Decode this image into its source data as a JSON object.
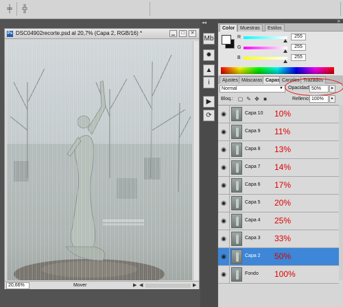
{
  "options_bar": {
    "tool_icons": [
      "align-center-icon",
      "distribute-icon"
    ]
  },
  "document": {
    "title": "DSC04902recorte.psd al 20,7% (Capa 2, RGB/16) *",
    "zoom": "20,66%",
    "status": "Mover"
  },
  "side_icons": [
    "mini-bridge-icon",
    "navigator-icon",
    "histogram-icon",
    "info-icon",
    "actions-icon",
    "history-icon"
  ],
  "color_panel": {
    "tabs": [
      "Color",
      "Muestras",
      "Estilos"
    ],
    "channels": [
      {
        "label": "R",
        "value": "255",
        "color": "#ff2020"
      },
      {
        "label": "G",
        "value": "255",
        "color": "#e020e0"
      },
      {
        "label": "B",
        "value": "255",
        "color": "#e0e020"
      }
    ]
  },
  "layers_panel": {
    "tabs": [
      "Ajustes",
      "Máscaras",
      "Capas",
      "Canales",
      "Trazados"
    ],
    "blend_mode": "Normal",
    "opacity_label": "Opacidad:",
    "opacity_value": "50%",
    "lock_label": "Bloq.:",
    "fill_label": "Relleno:",
    "fill_value": "100%",
    "layers": [
      {
        "name": "Capa 10",
        "note": "10%",
        "selected": false
      },
      {
        "name": "Capa 9",
        "note": "11%",
        "selected": false
      },
      {
        "name": "Capa 8",
        "note": "13%",
        "selected": false
      },
      {
        "name": "Capa 7",
        "note": "14%",
        "selected": false
      },
      {
        "name": "Capa 6",
        "note": "17%",
        "selected": false
      },
      {
        "name": "Capa 5",
        "note": "20%",
        "selected": false
      },
      {
        "name": "Capa 4",
        "note": "25%",
        "selected": false
      },
      {
        "name": "Capa 3",
        "note": "33%",
        "selected": false
      },
      {
        "name": "Capa 2",
        "note": "50%",
        "selected": true
      },
      {
        "name": "Fondo",
        "note": "100%",
        "selected": false
      }
    ]
  }
}
